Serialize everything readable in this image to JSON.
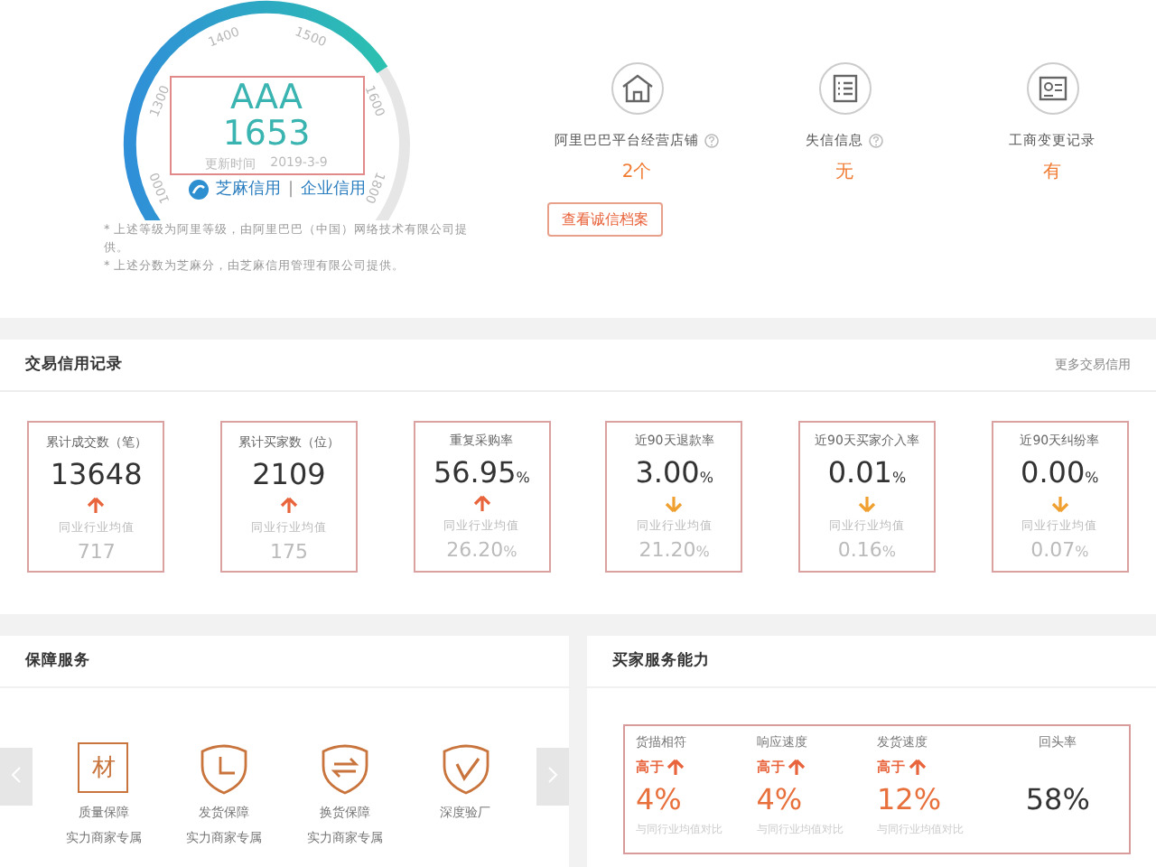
{
  "credit": {
    "gauge": {
      "ticks": [
        "1000",
        "1300",
        "1400",
        "1500",
        "1600",
        "1800"
      ]
    },
    "rating": "AAA",
    "score": "1653",
    "updated_label": "更新时间",
    "updated": "2019-3-9",
    "logo": {
      "name": "芝麻信用",
      "separator": "|",
      "product": "企业信用"
    },
    "notes": [
      "* 上述等级为阿里等级，由阿里巴巴（中国）网络技术有限公司提供。",
      "* 上述分数为芝麻分，由芝麻信用管理有限公司提供。"
    ]
  },
  "info": {
    "items": [
      {
        "kind": "shop",
        "label": "阿里巴巴平台经营店铺",
        "help": true,
        "value": "2个"
      },
      {
        "kind": "list",
        "label": "失信信息",
        "help": true,
        "value": "无"
      },
      {
        "kind": "card",
        "label": "工商变更记录",
        "value": "有"
      }
    ],
    "button": "查看诚信档案"
  },
  "trade": {
    "title": "交易信用记录",
    "more": "更多交易信用",
    "cards": [
      {
        "label": "累计成交数（笔）",
        "value": "13648",
        "up": true,
        "compare_label": "同业行业均值",
        "compare": "717"
      },
      {
        "label": "累计买家数（位）",
        "value": "2109",
        "up": true,
        "compare_label": "同业行业均值",
        "compare": "175"
      },
      {
        "label": "重复采购率",
        "value": "56.95",
        "unit": "%",
        "up": true,
        "compare_label": "同业行业均值",
        "compare": "26.20",
        "compare_unit": "%"
      },
      {
        "label": "近90天退款率",
        "value": "3.00",
        "unit": "%",
        "up": false,
        "compare_label": "同业行业均值",
        "compare": "21.20",
        "compare_unit": "%"
      },
      {
        "label": "近90天买家介入率",
        "value": "0.01",
        "unit": "%",
        "up": false,
        "compare_label": "同业行业均值",
        "compare": "0.16",
        "compare_unit": "%"
      },
      {
        "label": "近90天纠纷率",
        "value": "0.00",
        "unit": "%",
        "up": false,
        "compare_label": "同业行业均值",
        "compare": "0.07",
        "compare_unit": "%"
      }
    ]
  },
  "guarantee": {
    "title": "保障服务",
    "items": [
      {
        "kind": "material",
        "glyph": "材",
        "name": "质量保障",
        "sub": "实力商家专属"
      },
      {
        "kind": "clock",
        "name": "发货保障",
        "sub": "实力商家专属"
      },
      {
        "kind": "swap",
        "name": "换货保障",
        "sub": "实力商家专属"
      },
      {
        "kind": "check",
        "name": "深度验厂"
      }
    ]
  },
  "service": {
    "title": "买家服务能力",
    "items": [
      {
        "label": "货描相符",
        "compare": "高于",
        "up": true,
        "value": "4%",
        "note": "与同行业均值对比"
      },
      {
        "label": "响应速度",
        "compare": "高于",
        "up": true,
        "value": "4%",
        "note": "与同行业均值对比"
      },
      {
        "label": "发货速度",
        "compare": "高于",
        "up": true,
        "value": "12%",
        "note": "与同行业均值对比"
      },
      {
        "label": "回头率",
        "value": "58%"
      }
    ]
  }
}
